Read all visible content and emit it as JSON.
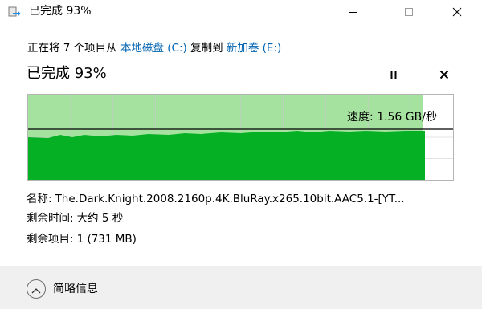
{
  "window": {
    "title": "已完成 93%",
    "minimize_icon": "minimize-icon",
    "maximize_icon": "maximize-icon",
    "close_icon": "close-icon"
  },
  "copy": {
    "prefix": "正在将 7 个项目从 ",
    "source": "本地磁盘 (C:)",
    "middle": " 复制到 ",
    "destination": "新加卷 (E:)"
  },
  "progress": {
    "heading": "已完成 93%",
    "percent": 93,
    "pause_icon": "pause-icon",
    "cancel_icon": "close-icon"
  },
  "speed": {
    "label": "速度: 1.56 GB/秒"
  },
  "details": {
    "name_label": "名称:",
    "name_value": "The.Dark.Knight.2008.2160p.4K.BluRay.x265.10bit.AAC5.1-[YT...",
    "time_label": "剩余时间:",
    "time_value": "大约 5 秒",
    "items_label": "剩余项目:",
    "items_value": "1 (731 MB)"
  },
  "footer": {
    "toggle_icon": "chevron-up-icon",
    "toggle_label": "简略信息"
  },
  "colors": {
    "progress_fill": "#a6e29f",
    "throughput_fill": "#06b025",
    "link": "#0063b1"
  }
}
